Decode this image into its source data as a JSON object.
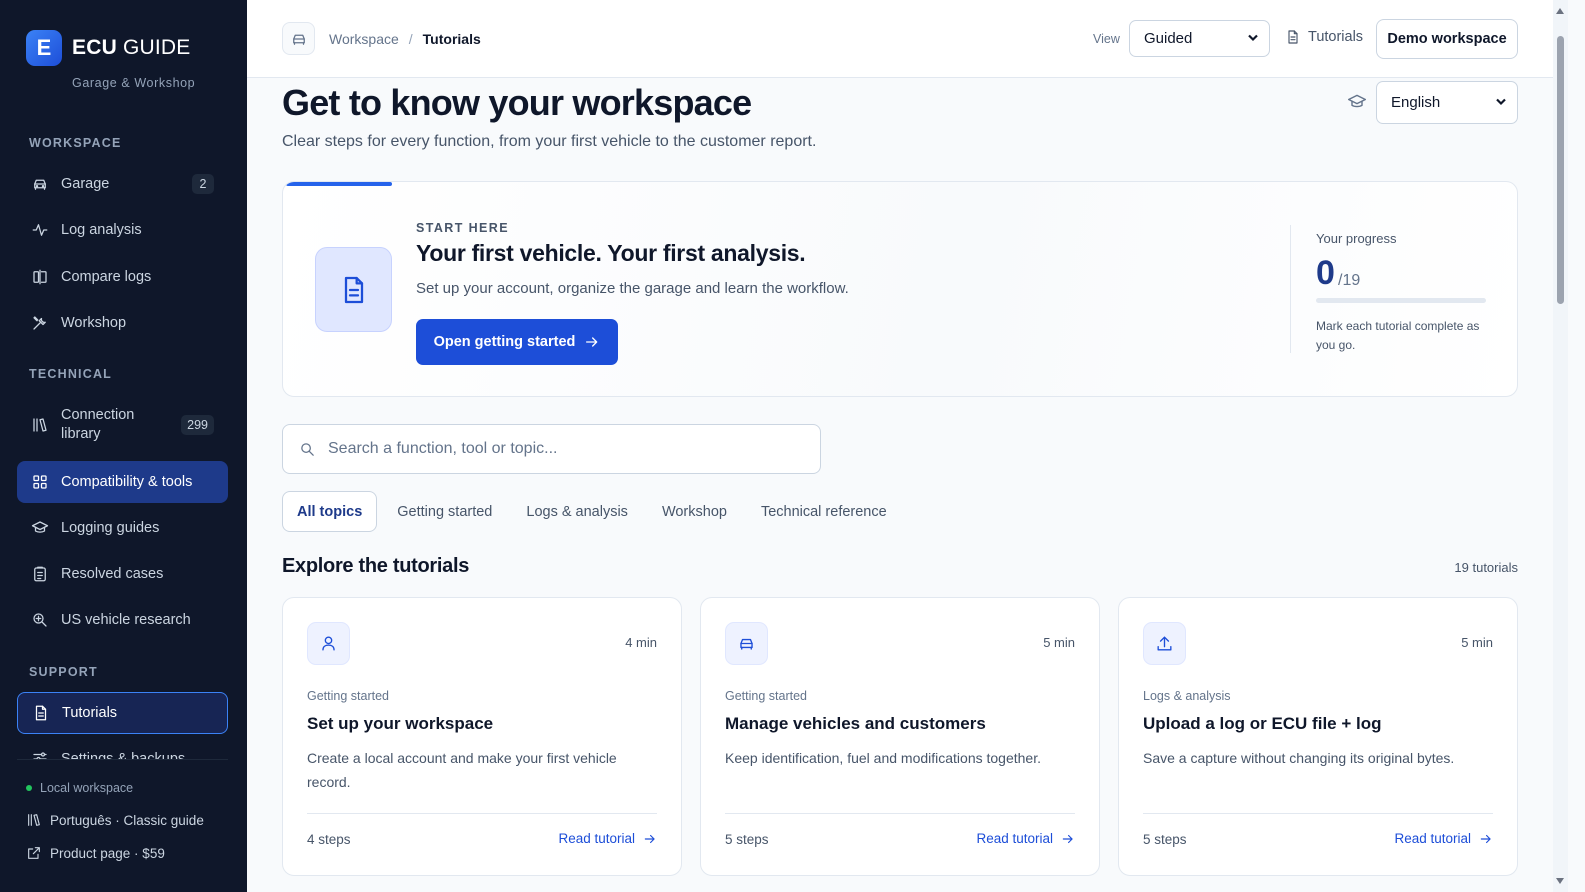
{
  "brand": {
    "logo_letter": "E",
    "name_bold": "ECU",
    "name_rest": " GUIDE",
    "subtitle": "Garage & Workshop"
  },
  "sidebar": {
    "sections": [
      {
        "title": "WORKSPACE"
      },
      {
        "title": "TECHNICAL"
      },
      {
        "title": "SUPPORT"
      }
    ],
    "items": [
      {
        "label": "Garage",
        "badge": "2",
        "icon": "car-icon"
      },
      {
        "label": "Log analysis",
        "icon": "activity-icon"
      },
      {
        "label": "Compare logs",
        "icon": "compare-icon"
      },
      {
        "label": "Workshop",
        "icon": "tools-icon"
      },
      {
        "label": "Connection library",
        "badge": "299",
        "icon": "library-icon"
      },
      {
        "label": "Compatibility & tools",
        "icon": "grid-icon",
        "state": "active"
      },
      {
        "label": "Logging guides",
        "icon": "graduation-cap-icon"
      },
      {
        "label": "Resolved cases",
        "icon": "clipboard-icon"
      },
      {
        "label": "US vehicle research",
        "icon": "search-zoom-icon"
      },
      {
        "label": "Tutorials",
        "icon": "document-icon",
        "state": "current"
      },
      {
        "label": "Settings & backups",
        "icon": "settings-icon"
      }
    ],
    "footer": {
      "status": "Local workspace",
      "language_link": "Português · Classic guide",
      "product_link": "Product page · $59"
    }
  },
  "topbar": {
    "breadcrumb": [
      "Workspace",
      "Tutorials"
    ],
    "view_label": "View",
    "view_select": "Guided",
    "tutorials_link": "Tutorials",
    "demo_button": "Demo workspace"
  },
  "page": {
    "title": "Get to know your workspace",
    "subtitle": "Clear steps for every function, from your first vehicle to the customer report.",
    "language_select": "English"
  },
  "hero": {
    "kicker": "START HERE",
    "title": "Your first vehicle. Your first analysis.",
    "subtitle": "Set up your account, organize the garage and learn the workflow.",
    "button": "Open getting started",
    "progress": {
      "label": "Your progress",
      "value": "0",
      "total": "/19",
      "fraction": 0,
      "note": "Mark each tutorial complete as you go."
    }
  },
  "search": {
    "placeholder": "Search a function, tool or topic..."
  },
  "tabs": [
    {
      "label": "All topics",
      "active": true
    },
    {
      "label": "Getting started"
    },
    {
      "label": "Logs & analysis"
    },
    {
      "label": "Workshop"
    },
    {
      "label": "Technical reference"
    }
  ],
  "tutorials": {
    "title": "Explore the tutorials",
    "count": "19 tutorials",
    "link_label": "Read tutorial",
    "cards": [
      {
        "icon": "user-icon",
        "time": "4 min",
        "category": "Getting started",
        "title": "Set up your workspace",
        "desc": "Create a local account and make your first vehicle record.",
        "steps": "4 steps"
      },
      {
        "icon": "car-icon",
        "time": "5 min",
        "category": "Getting started",
        "title": "Manage vehicles and customers",
        "desc": "Keep identification, fuel and modifications together.",
        "steps": "5 steps"
      },
      {
        "icon": "upload-icon",
        "time": "5 min",
        "category": "Logs & analysis",
        "title": "Upload a log or ECU file + log",
        "desc": "Save a capture without changing its original bytes.",
        "steps": "5 steps"
      }
    ]
  },
  "colors": {
    "sidebar_bg": "#0f172a",
    "accent": "#1d4ed8",
    "active_item": "#1e3a8a"
  }
}
